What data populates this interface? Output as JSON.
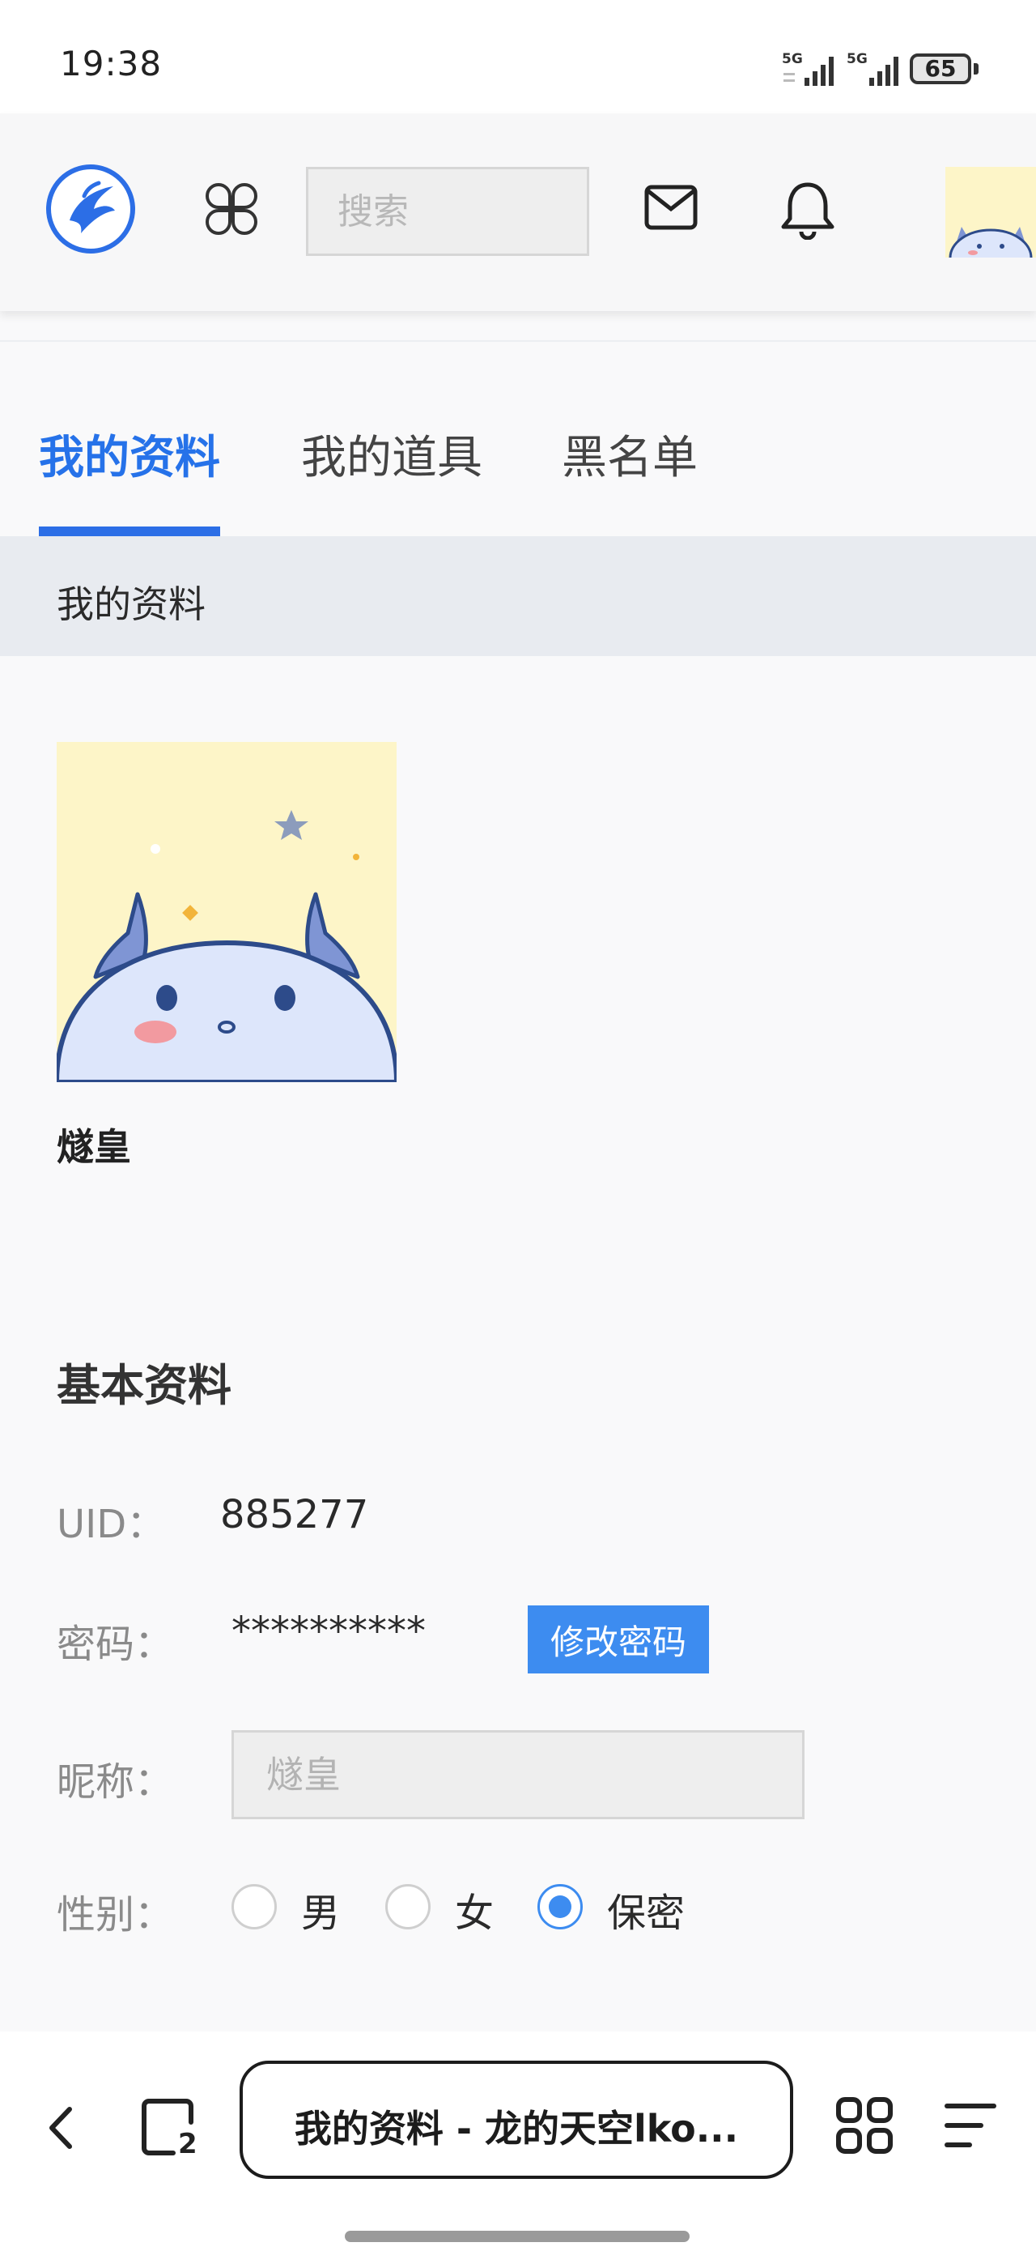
{
  "status": {
    "time": "19:38",
    "signal1": "5G",
    "signal2": "5G",
    "battery": "65"
  },
  "header": {
    "search_placeholder": "搜索"
  },
  "tabs": [
    {
      "label": "我的资料",
      "active": true
    },
    {
      "label": "我的道具",
      "active": false
    },
    {
      "label": "黑名单",
      "active": false
    }
  ],
  "section_title": "我的资料",
  "profile": {
    "name": "燧皇"
  },
  "basic": {
    "title": "基本资料",
    "uid_label": "UID：",
    "uid_value": "885277",
    "password_label": "密码：",
    "password_value": "**********",
    "change_password_button": "修改密码",
    "nickname_label": "昵称：",
    "nickname_placeholder": "燧皇",
    "gender_label": "性别：",
    "gender_options": [
      "男",
      "女",
      "保密"
    ],
    "gender_selected": "保密"
  },
  "browser": {
    "tab_count": "2",
    "page_title": "我的资料 - 龙的天空lko..."
  },
  "colors": {
    "accent": "#2672e9",
    "button": "#3d8cf0",
    "section_bg": "#e8ebf0"
  }
}
